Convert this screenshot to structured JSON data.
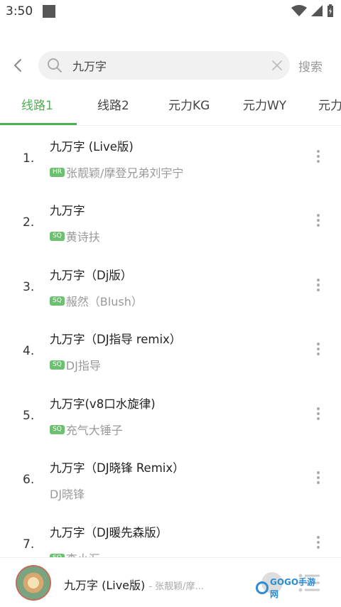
{
  "status_bar": {
    "time": "3:50"
  },
  "search": {
    "value": "九万字",
    "button_label": "搜索"
  },
  "tabs": [
    {
      "label": "线路1"
    },
    {
      "label": "线路2"
    },
    {
      "label": "元力KG"
    },
    {
      "label": "元力WY"
    },
    {
      "label": "元力"
    }
  ],
  "songs": [
    {
      "index": "1.",
      "title": "九万字 (Live版)",
      "badge": "HR",
      "artist": "张靓颖/摩登兄弟刘宇宁"
    },
    {
      "index": "2.",
      "title": "九万字",
      "badge": "SQ",
      "artist": "黄诗扶"
    },
    {
      "index": "3.",
      "title": "九万字（Dj版）",
      "badge": "SQ",
      "artist": "赧然（Blush）"
    },
    {
      "index": "4.",
      "title": "九万字（DJ指导 remix）",
      "badge": "SQ",
      "artist": "DJ指导"
    },
    {
      "index": "5.",
      "title": "九万字(v8口水旋律)",
      "badge": "SQ",
      "artist": "充气大锤子"
    },
    {
      "index": "6.",
      "title": "九万字（DJ晓锋 Remix）",
      "badge": "",
      "artist": "DJ晓锋"
    },
    {
      "index": "7.",
      "title": "九万字（DJ暖先森版）",
      "badge": "SQ",
      "artist": "李小汇"
    }
  ],
  "player": {
    "title": "九万字 (Live版)",
    "artist": "- 张靓颖/摩..."
  },
  "watermark": {
    "text": "GOGO手游网"
  },
  "colors": {
    "accent": "#4caf50",
    "badge": "#6cc06f"
  }
}
